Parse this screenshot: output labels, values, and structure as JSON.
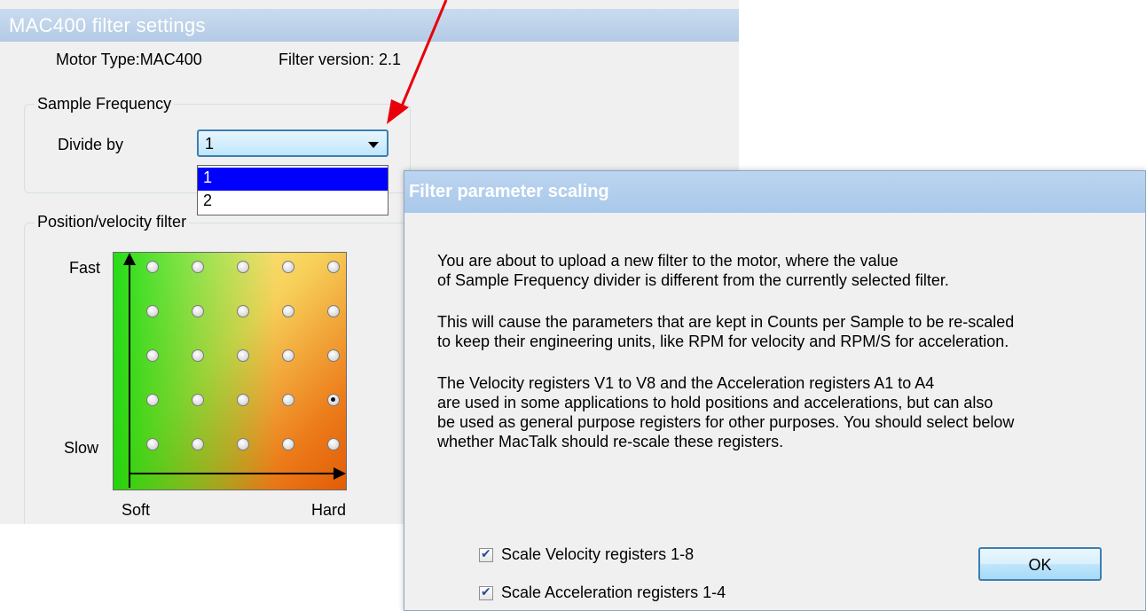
{
  "filter_window": {
    "title": "MAC400 filter settings",
    "motor_type": "Motor Type:MAC400",
    "filter_version": "Filter version: 2.1",
    "sample_frequency": {
      "group_label": "Sample Frequency",
      "divide_by_label": "Divide by",
      "selected_value": "1",
      "options": [
        "1",
        "2"
      ]
    },
    "position_velocity_filter": {
      "group_label": "Position/velocity filter",
      "fast_label": "Fast",
      "slow_label": "Slow",
      "soft_label": "Soft",
      "hard_label": "Hard",
      "grid_rows": 5,
      "grid_cols": 5,
      "selected_row": 4,
      "selected_col": 5
    }
  },
  "scaling_dialog": {
    "title": "Filter parameter scaling",
    "message": [
      "You are about to upload a new filter to the motor, where the value\nof Sample Frequency divider is different from the currently selected filter.",
      "This will cause the parameters that are kept in Counts per Sample to be re-scaled\nto keep their engineering units, like RPM for velocity and RPM/S for acceleration.",
      "The Velocity registers V1 to V8 and the Acceleration registers A1 to A4\nare used in some applications to hold positions and accelerations, but can also\nbe used as general purpose registers for other purposes. You should select below\nwhether MacTalk should re-scale these registers."
    ],
    "checkboxes": [
      {
        "label": "Scale Velocity registers 1-8",
        "checked": true
      },
      {
        "label": "Scale Acceleration registers 1-4",
        "checked": true
      }
    ],
    "ok_label": "OK"
  },
  "annotation": {
    "arrow_color": "#e8000b"
  }
}
